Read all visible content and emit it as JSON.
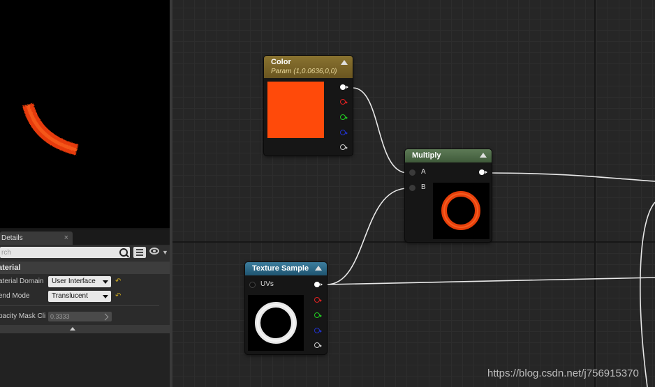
{
  "details_panel": {
    "tab_label": "Details",
    "close_glyph": "×",
    "search_placeholder": "rch",
    "section_title": "aterial",
    "properties": [
      {
        "label": "aterial Domain",
        "value": "User Interface"
      },
      {
        "label": "end Mode",
        "value": "Translucent"
      },
      {
        "label": "pacity Mask Cli",
        "value": "0.3333"
      }
    ],
    "reset_glyph": "↶"
  },
  "nodes": {
    "color": {
      "title": "Color",
      "subtitle": "Param (1,0.0636,0,0)",
      "swatch_color": "#ff4a0a",
      "header_color": "#7a6420",
      "output_pins": [
        "white",
        "red",
        "green",
        "blue",
        "alpha"
      ]
    },
    "multiply": {
      "title": "Multiply",
      "header_color": "#4f6b4a",
      "inputs": [
        "A",
        "B"
      ],
      "preview": "orange-ring"
    },
    "texture_sample": {
      "title": "Texture Sample",
      "header_color": "#2e6b8a",
      "inputs": [
        "UVs"
      ],
      "output_pins": [
        "white",
        "red",
        "green",
        "blue",
        "alpha"
      ],
      "preview": "white-ring"
    }
  },
  "pin_colors": {
    "red": "#dd2222",
    "green": "#22cc22",
    "blue": "#2233cc",
    "alpha": "#cccccc"
  },
  "watermark": "https://blog.csdn.net/j756915370"
}
